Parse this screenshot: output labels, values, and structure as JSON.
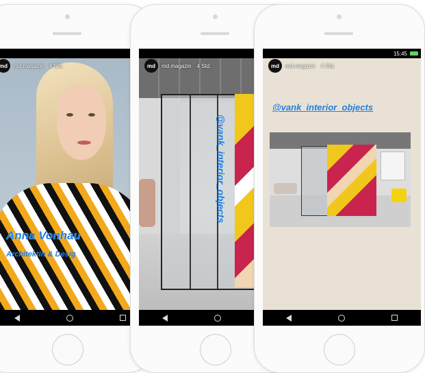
{
  "story_header": {
    "avatar_text": "md",
    "account": "md.magazin",
    "age": "4 Std."
  },
  "status_bar": {
    "time": "15:45"
  },
  "story_1": {
    "name": "Anna Vonhau",
    "role": "Architektin & Desig"
  },
  "story_2": {
    "vertical_text": "@vank_interior_objects"
  },
  "story_3": {
    "mention": "@vank_interior_objects"
  },
  "colors": {
    "accent_text": "#1f7fe6"
  }
}
